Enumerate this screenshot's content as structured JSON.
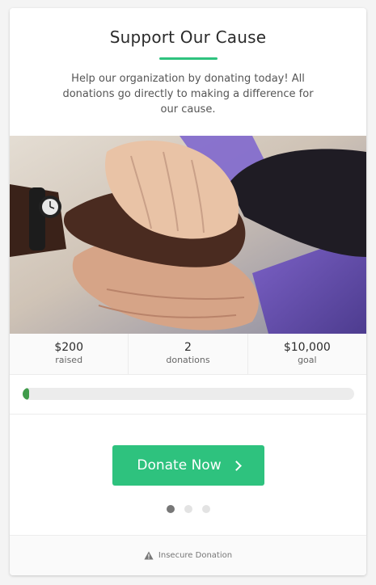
{
  "card": {
    "title": "Support Our Cause",
    "description": "Help our organization by donating today! All donations go directly to making a difference for our cause.",
    "accent_color": "#2ec27e"
  },
  "image": {
    "subject": "hands-stacked-together-photo"
  },
  "stats": [
    {
      "value": "$200",
      "label": "raised"
    },
    {
      "value": "2",
      "label": "donations"
    },
    {
      "value": "$10,000",
      "label": "goal"
    }
  ],
  "progress": {
    "percent": 2,
    "fill_color": "#3f9b4a"
  },
  "donate": {
    "button_label": "Donate Now",
    "icon": "chevron-right-icon"
  },
  "carousel": {
    "dot_count": 3,
    "active_index": 0
  },
  "footer": {
    "icon": "warning-icon",
    "text": "Insecure Donation"
  }
}
